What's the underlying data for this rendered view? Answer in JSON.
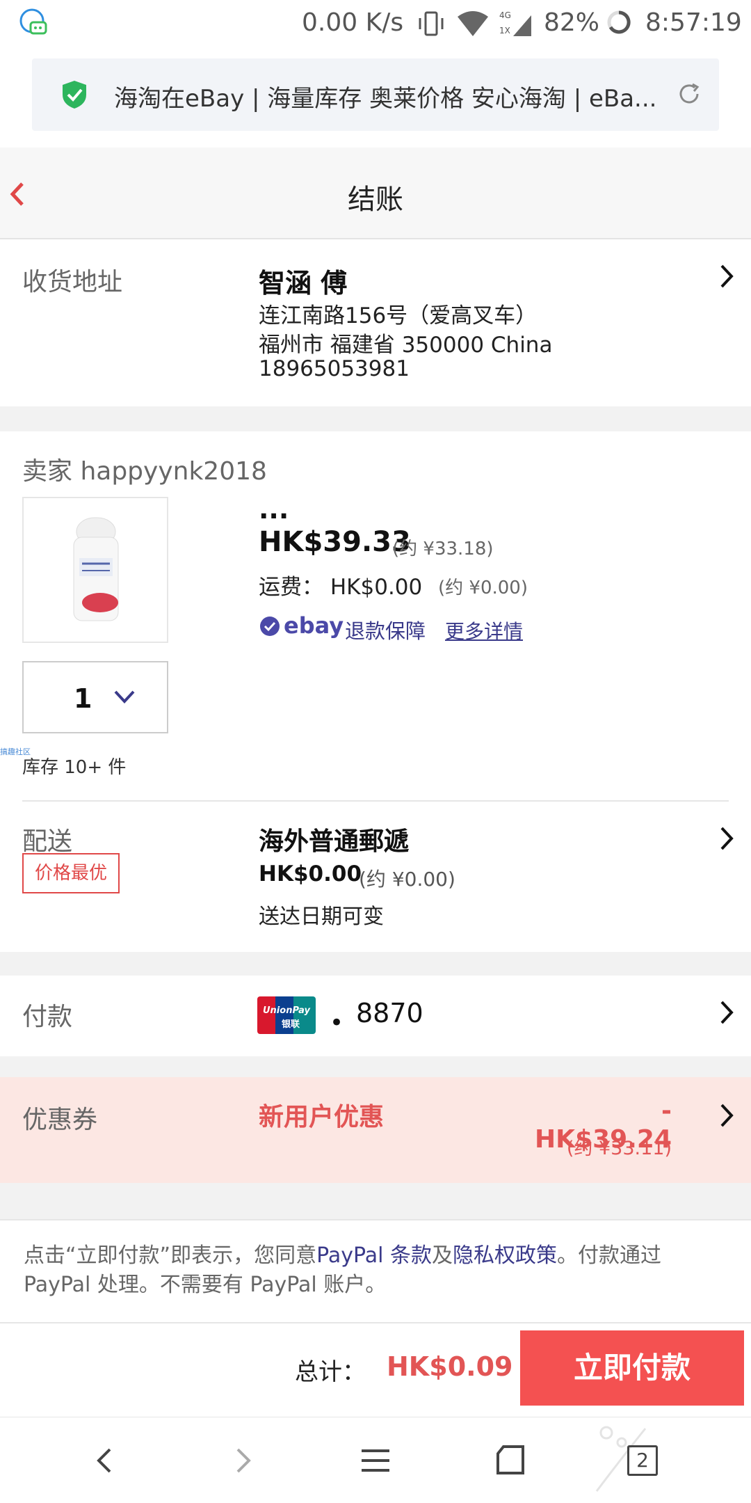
{
  "status_bar": {
    "speed": "0.00 K/s",
    "battery": "82%",
    "time": "8:57:19",
    "network": "4G"
  },
  "url_bar": {
    "text": "海淘在eBay | 海量库存 奥莱价格 安心海淘 | eBa..."
  },
  "header": {
    "title": "结账"
  },
  "address": {
    "label": "收货地址",
    "name": "智涵 傅",
    "line1": "连江南路156号（爱高叉车）",
    "line2": "福州市 福建省 350000 China",
    "phone": "18965053981"
  },
  "item": {
    "seller": "卖家 happyynk2018",
    "title": "...",
    "price": "HK$39.33",
    "price_cny": "(约 ¥33.18)",
    "shipping_label": "运费：  HK$0.00",
    "shipping_cny": "(约 ¥0.00)",
    "ebay_logo": "ebay",
    "refund": "退款保障",
    "more": "更多详情",
    "quantity": "1",
    "stock": "库存 10+ 件",
    "watermark": "搞趣社区"
  },
  "delivery": {
    "label": "配送",
    "badge": "价格最优",
    "method": "海外普通郵遞",
    "price": "HK$0.00",
    "price_cny": "(约 ¥0.00)",
    "date": "送达日期可变"
  },
  "payment": {
    "label": "付款",
    "dot": "•",
    "card_last4": "8870",
    "card_brand_top": "UnionPay",
    "card_brand_bottom": "银联"
  },
  "coupon": {
    "label": "优惠券",
    "name": "新用户优惠",
    "amount": "-HK$39.24",
    "amount_cny": "(约 ¥33.11)"
  },
  "notice": {
    "part1": "点击“立即付款”即表示，您同意",
    "link1": "PayPal 条款",
    "part2": "及",
    "link2": "隐私权政策",
    "part3": "。付款通过 PayPal 处理。不需要有 PayPal 账户。"
  },
  "footer": {
    "total_label": "总计：",
    "total_value": "HK$0.09",
    "pay_button": "立即付款"
  },
  "nav": {
    "tabs_count": "2"
  },
  "colors": {
    "accent_red": "#f45151",
    "coupon_bg": "#fce7e3",
    "ebay_purple": "#3a3a8a",
    "shield_green": "#2db55d"
  }
}
